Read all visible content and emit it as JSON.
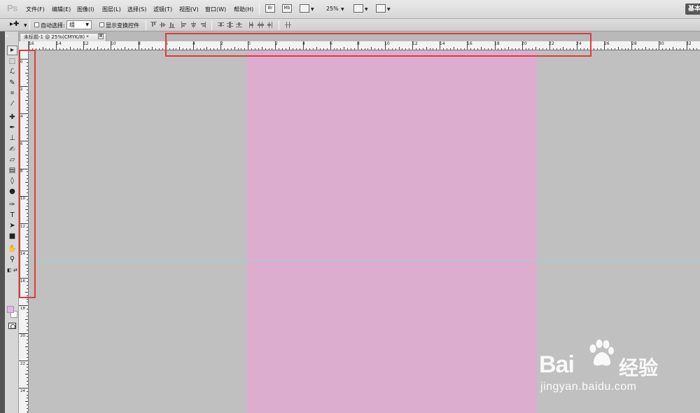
{
  "app": {
    "logo": "Ps"
  },
  "menu": [
    "文件(F)",
    "编辑(E)",
    "图像(I)",
    "图层(L)",
    "选择(S)",
    "滤镜(T)",
    "视图(V)",
    "窗口(W)",
    "帮助(H)"
  ],
  "menubar_icons": {
    "bridge": "Br",
    "minibridge": "Mb"
  },
  "zoom": {
    "level": "25%"
  },
  "workspace": {
    "label": "基本"
  },
  "options": {
    "auto_select_label": "自动选择:",
    "auto_select_value": "组",
    "show_transform_label": "显示变换控件"
  },
  "document": {
    "tab_title": "未标题-1 @ 25%(CMYK/8) *",
    "close_glyph": "⊠"
  },
  "rulers": {
    "horizontal_labels": [
      "16",
      "14",
      "12",
      "10",
      "8",
      "6",
      "4",
      "2",
      "0",
      "2",
      "4",
      "6",
      "8",
      "10",
      "12",
      "14",
      "16",
      "18",
      "20",
      "22",
      "24",
      "26",
      "28",
      "30",
      "32"
    ],
    "vertical_labels": [
      "0",
      "2",
      "4",
      "6",
      "8",
      "10",
      "12",
      "14",
      "16",
      "18",
      "20",
      "22",
      "24"
    ]
  },
  "colors": {
    "foreground": "#e6b6e6",
    "background": "#ffffff",
    "canvas": "#dcadcf",
    "guide": "#8fd6df",
    "highlight": "#e03a3a"
  },
  "watermark": {
    "brand": "Bai",
    "brand_cn": "经验",
    "url": "jingyan.baidu.com"
  }
}
